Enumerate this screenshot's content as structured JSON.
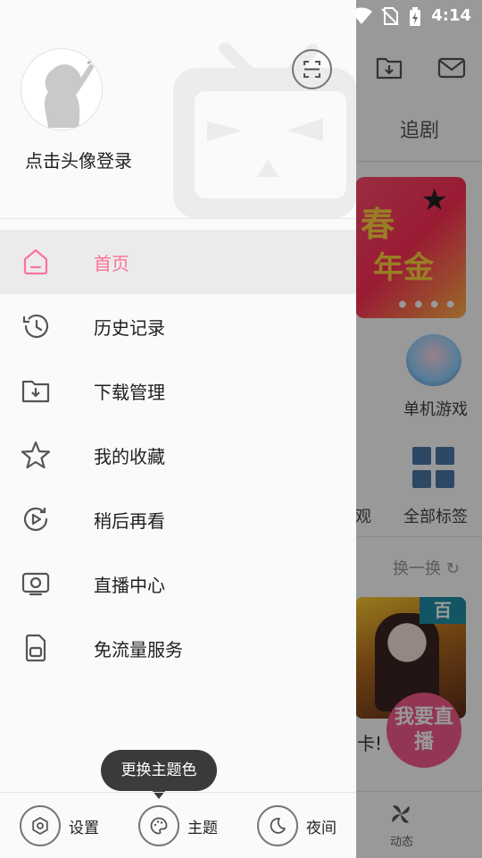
{
  "status_bar": {
    "time": "4:14"
  },
  "background_app": {
    "tab_label": "追剧",
    "entries": {
      "games": "单机游戏",
      "all_tags": "全部标签",
      "partial_left": "观"
    },
    "refresh_label": "换一换",
    "card_tag": "百",
    "card_text": "卡!",
    "fab_label": "我要直播",
    "bottom_tab": "动态"
  },
  "drawer": {
    "login_prompt": "点击头像登录",
    "menu": [
      {
        "label": "首页",
        "icon": "home-icon",
        "active": true
      },
      {
        "label": "历史记录",
        "icon": "history-icon",
        "active": false
      },
      {
        "label": "下载管理",
        "icon": "download-folder-icon",
        "active": false
      },
      {
        "label": "我的收藏",
        "icon": "star-icon",
        "active": false
      },
      {
        "label": "稍后再看",
        "icon": "watch-later-icon",
        "active": false
      },
      {
        "label": "直播中心",
        "icon": "live-tv-icon",
        "active": false
      },
      {
        "label": "免流量服务",
        "icon": "sim-card-icon",
        "active": false
      }
    ],
    "tooltip": "更换主题色",
    "bottom": {
      "settings": "设置",
      "theme": "主题",
      "night": "夜间"
    }
  },
  "colors": {
    "accent": "#fb7299",
    "scrim": "rgba(0,0,0,0.4)"
  }
}
